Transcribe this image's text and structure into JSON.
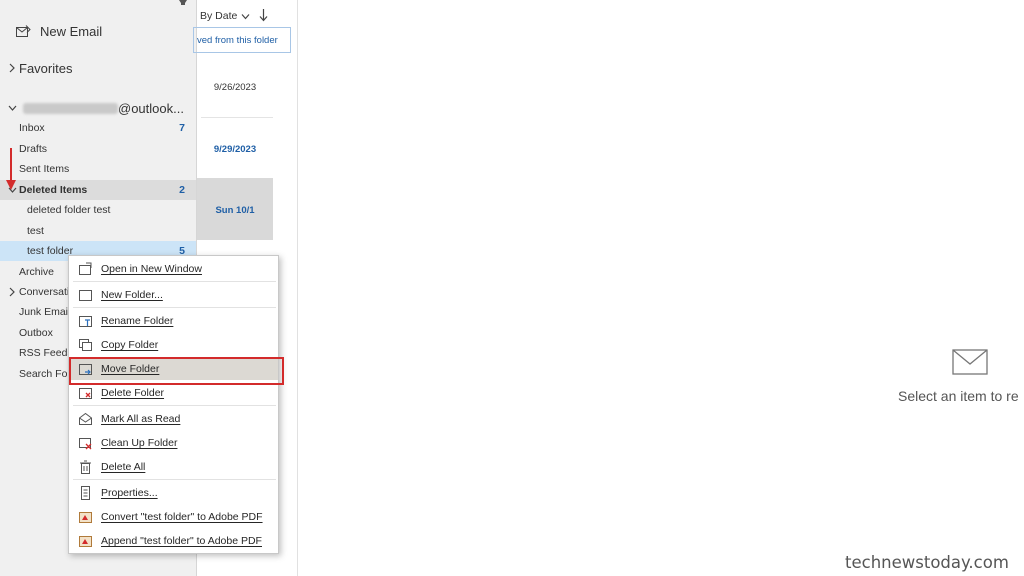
{
  "nav": {
    "new_email": "New Email",
    "favorites": "Favorites",
    "account_suffix": "@outlook...",
    "folders": [
      {
        "label": "Inbox",
        "count": "7"
      },
      {
        "label": "Drafts",
        "count": ""
      },
      {
        "label": "Sent Items",
        "count": ""
      },
      {
        "label": "Deleted Items",
        "count": "2"
      },
      {
        "label": "deleted folder test",
        "count": ""
      },
      {
        "label": "test",
        "count": ""
      },
      {
        "label": "test folder",
        "count": "5"
      },
      {
        "label": "Archive",
        "count": ""
      },
      {
        "label": "Conversati",
        "count": ""
      },
      {
        "label": "Junk Email",
        "count": ""
      },
      {
        "label": "Outbox",
        "count": ""
      },
      {
        "label": "RSS Feeds",
        "count": ""
      },
      {
        "label": "Search Fold",
        "count": ""
      }
    ]
  },
  "list": {
    "sort_label": "By Date",
    "restore_link": "ved from this folder",
    "messages": [
      {
        "date": "9/26/2023"
      },
      {
        "date": "9/29/2023"
      },
      {
        "date": "Sun 10/1"
      }
    ]
  },
  "context_menu": {
    "items": [
      {
        "label": "Open in New Window",
        "icon": "open-window-icon"
      },
      {
        "label": "New Folder...",
        "icon": "new-folder-icon"
      },
      {
        "label": "Rename Folder",
        "icon": "rename-folder-icon"
      },
      {
        "label": "Copy Folder",
        "icon": "copy-folder-icon"
      },
      {
        "label": "Move Folder",
        "icon": "move-folder-icon"
      },
      {
        "label": "Delete Folder",
        "icon": "delete-folder-icon"
      },
      {
        "label": "Mark All as Read",
        "icon": "mark-read-icon"
      },
      {
        "label": "Clean Up Folder",
        "icon": "clean-up-icon"
      },
      {
        "label": "Delete All",
        "icon": "delete-all-icon"
      },
      {
        "label": "Properties...",
        "icon": "properties-icon"
      },
      {
        "label": "Convert \"test folder\" to Adobe PDF",
        "icon": "pdf-convert-icon"
      },
      {
        "label": "Append \"test folder\" to Adobe PDF",
        "icon": "pdf-append-icon"
      }
    ]
  },
  "reading": {
    "empty_message": "Select an item to re"
  },
  "watermark": "technewstoday.com",
  "colors": {
    "accent_blue": "#1f5fa6",
    "highlight_red": "#d32b2b",
    "selection_blue": "#cce4f7"
  }
}
